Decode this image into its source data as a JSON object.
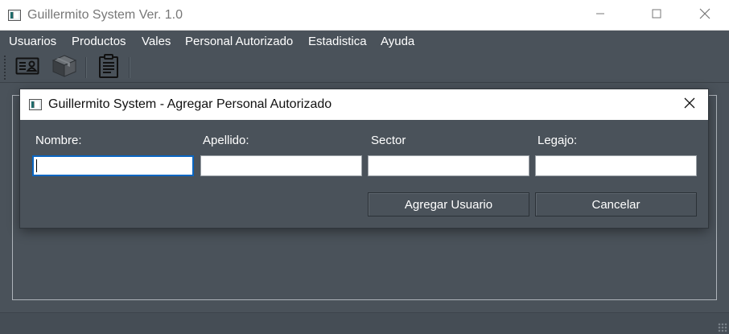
{
  "window": {
    "title": "Guillermito System Ver. 1.0"
  },
  "menu": {
    "items": [
      "Usuarios",
      "Productos",
      "Vales",
      "Personal Autorizado",
      "Estadistica",
      "Ayuda"
    ]
  },
  "toolbar": {
    "buttons": [
      {
        "icon": "id-card-icon",
        "enabled": true
      },
      {
        "icon": "package-box-icon",
        "enabled": false
      },
      {
        "icon": "clipboard-list-icon",
        "enabled": true
      }
    ]
  },
  "dialog": {
    "title": "Guillermito System - Agregar Personal Autorizado",
    "fields": [
      {
        "label": "Nombre:",
        "value": "",
        "focused": true
      },
      {
        "label": "Apellido:",
        "value": ""
      },
      {
        "label": "Sector",
        "value": ""
      },
      {
        "label": "Legajo:",
        "value": ""
      }
    ],
    "add_button": "Agregar Usuario",
    "cancel_button": "Cancelar"
  },
  "colors": {
    "background": "#4a525a",
    "titlebar": "#ffffff",
    "focus_border": "#0a66c2",
    "text_on_dark": "#ffffff"
  }
}
